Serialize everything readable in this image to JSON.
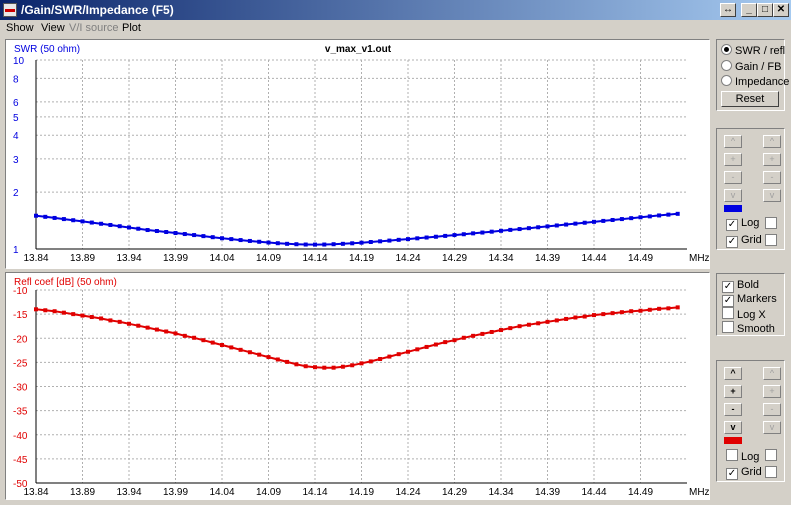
{
  "window": {
    "title": "/Gain/SWR/Impedance (F5)",
    "btn_restore": "↔",
    "btn_min": "_",
    "btn_max": "□",
    "btn_close": "✕"
  },
  "menu": [
    "Show",
    "View",
    "V/I source",
    "Plot"
  ],
  "side": {
    "radios": [
      "SWR / refl",
      "Gain / FB",
      "Impedance"
    ],
    "selected": 0,
    "reset_label": "Reset",
    "step_labels": [
      "^",
      "+",
      "-",
      "v"
    ],
    "top_controls": {
      "color": "#0000e0",
      "log_label": "Log",
      "log_checked": true,
      "grid_label": "Grid",
      "grid_checked": true
    },
    "opts": [
      {
        "label": "Bold",
        "checked": true
      },
      {
        "label": "Markers",
        "checked": true
      },
      {
        "label": "Log X",
        "checked": false
      },
      {
        "label": "Smooth",
        "checked": false
      }
    ],
    "bottom_controls": {
      "color": "#e00000",
      "log_label": "Log",
      "log_checked": false,
      "grid_label": "Grid",
      "grid_checked": true
    }
  },
  "chart_data": [
    {
      "type": "line",
      "title": "v_max_v1.out",
      "ylabel": "SWR (50 ohm)",
      "xunit": "MHz",
      "ylog": true,
      "ylim": [
        1,
        10
      ],
      "yticks": [
        1,
        2,
        3,
        4,
        5,
        6,
        8,
        10
      ],
      "xlim": [
        13.84,
        14.54
      ],
      "xticks": [
        "13.84",
        "13.89",
        "13.94",
        "13.99",
        "14.04",
        "14.09",
        "14.14",
        "14.19",
        "14.24",
        "14.29",
        "14.34",
        "14.39",
        "14.44",
        "14.49"
      ],
      "grid": true,
      "series": [
        {
          "color": "#0000e0",
          "x_start": 13.84,
          "x_step": 0.01,
          "values": [
            1.5,
            1.48,
            1.46,
            1.44,
            1.42,
            1.4,
            1.38,
            1.36,
            1.34,
            1.32,
            1.3,
            1.28,
            1.26,
            1.245,
            1.23,
            1.215,
            1.2,
            1.185,
            1.17,
            1.155,
            1.14,
            1.128,
            1.115,
            1.103,
            1.092,
            1.082,
            1.073,
            1.065,
            1.06,
            1.056,
            1.055,
            1.056,
            1.06,
            1.065,
            1.072,
            1.08,
            1.089,
            1.098,
            1.108,
            1.118,
            1.128,
            1.139,
            1.15,
            1.161,
            1.173,
            1.185,
            1.197,
            1.21,
            1.222,
            1.235,
            1.248,
            1.262,
            1.275,
            1.289,
            1.303,
            1.317,
            1.332,
            1.347,
            1.362,
            1.377,
            1.392,
            1.408,
            1.424,
            1.44,
            1.456,
            1.472,
            1.488,
            1.505,
            1.52,
            1.535
          ]
        }
      ]
    },
    {
      "type": "line",
      "title": "",
      "ylabel": "Refl coef [dB] (50 ohm)",
      "xunit": "MHz",
      "ylim": [
        -50,
        -10
      ],
      "yticks": [
        -10,
        -15,
        -20,
        -25,
        -30,
        -35,
        -40,
        -45,
        -50
      ],
      "xlim": [
        13.84,
        14.54
      ],
      "xticks": [
        "13.84",
        "13.89",
        "13.94",
        "13.99",
        "14.04",
        "14.09",
        "14.14",
        "14.19",
        "14.24",
        "14.29",
        "14.34",
        "14.39",
        "14.44",
        "14.49"
      ],
      "grid": true,
      "series": [
        {
          "color": "#e00000",
          "x_start": 13.84,
          "x_step": 0.01,
          "values": [
            -14,
            -14.2,
            -14.4,
            -14.7,
            -15,
            -15.3,
            -15.6,
            -15.9,
            -16.3,
            -16.6,
            -17,
            -17.4,
            -17.8,
            -18.2,
            -18.6,
            -19,
            -19.5,
            -19.9,
            -20.4,
            -20.9,
            -21.4,
            -21.9,
            -22.4,
            -22.9,
            -23.4,
            -23.9,
            -24.4,
            -24.9,
            -25.4,
            -25.8,
            -26,
            -26.1,
            -26.1,
            -25.9,
            -25.6,
            -25.2,
            -24.8,
            -24.3,
            -23.8,
            -23.3,
            -22.8,
            -22.3,
            -21.8,
            -21.3,
            -20.8,
            -20.4,
            -19.9,
            -19.5,
            -19.1,
            -18.7,
            -18.3,
            -17.9,
            -17.5,
            -17.2,
            -16.9,
            -16.6,
            -16.3,
            -16,
            -15.7,
            -15.5,
            -15.2,
            -15,
            -14.8,
            -14.6,
            -14.4,
            -14.3,
            -14.1,
            -13.9,
            -13.8,
            -13.6
          ]
        }
      ]
    }
  ]
}
